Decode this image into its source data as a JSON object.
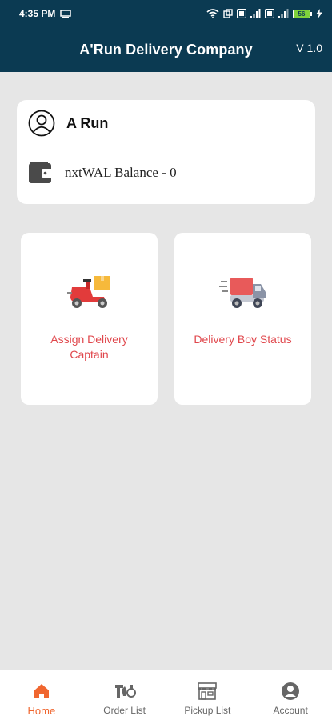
{
  "status_bar": {
    "time": "4:35 PM",
    "battery": "56",
    "icons": [
      "screen-icon",
      "wifi-icon",
      "portrait-icon",
      "volte-icon",
      "signal-icon",
      "volte-icon",
      "signal-icon",
      "battery-icon",
      "charging-icon"
    ]
  },
  "header": {
    "title": "A'Run Delivery Company",
    "version": "V 1.0",
    "bg_color": "#0b3a52"
  },
  "profile": {
    "name": "A Run",
    "wallet_label": "nxtWAL Balance - 0",
    "avatar_icon": "user-circle-icon",
    "wallet_icon": "wallet-icon"
  },
  "actions": [
    {
      "label": "Assign Delivery Captain",
      "icon": "delivery-scooter-icon"
    },
    {
      "label": "Delivery Boy Status",
      "icon": "delivery-truck-icon"
    }
  ],
  "accent_color": "#e0474c",
  "nav": {
    "items": [
      {
        "label": "Home",
        "icon": "home-icon",
        "active": true
      },
      {
        "label": "Order List",
        "icon": "order-list-icon",
        "active": false
      },
      {
        "label": "Pickup List",
        "icon": "store-icon",
        "active": false
      },
      {
        "label": "Account",
        "icon": "account-icon",
        "active": false
      }
    ],
    "active_color": "#f0662f"
  }
}
